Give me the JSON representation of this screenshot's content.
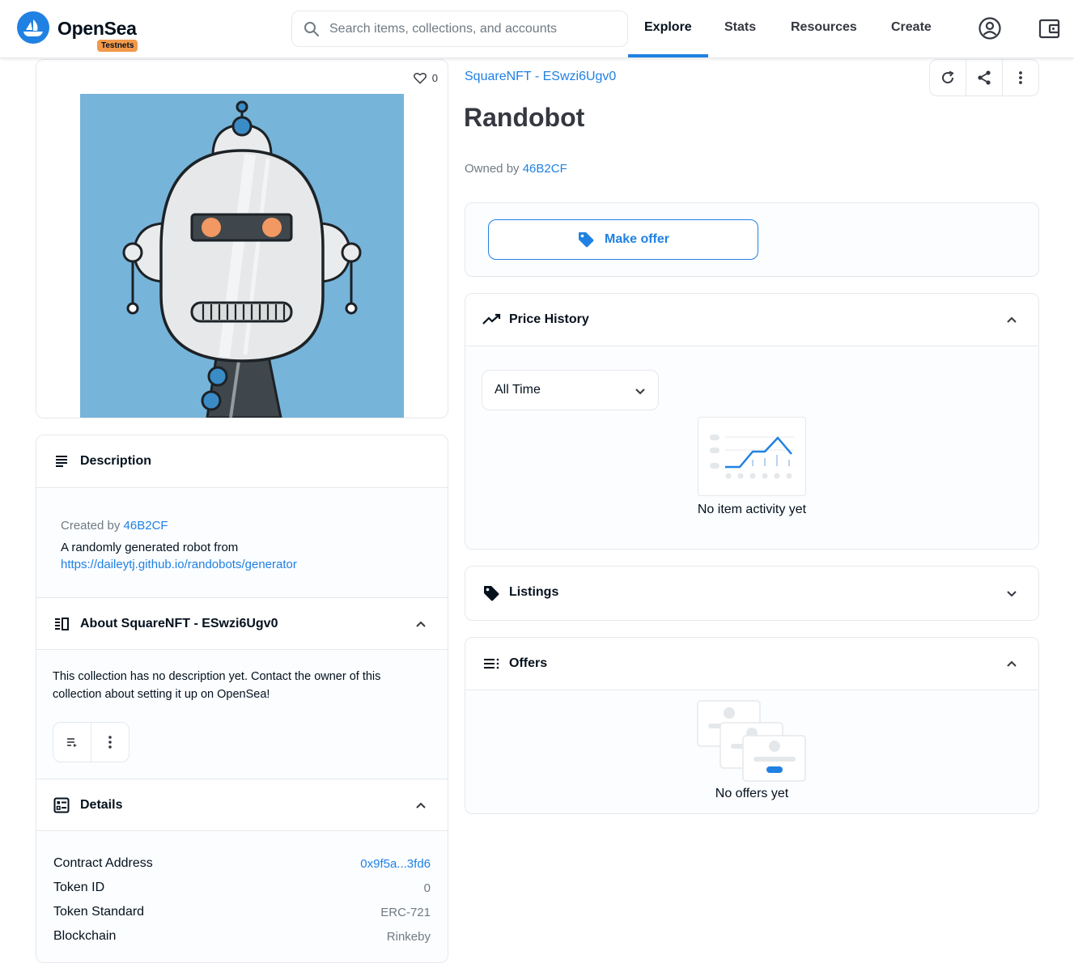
{
  "header": {
    "brand": "OpenSea",
    "badge": "Testnets",
    "search_placeholder": "Search items, collections, and accounts",
    "nav": [
      "Explore",
      "Stats",
      "Resources",
      "Create"
    ],
    "active_nav": "Explore",
    "accent_color": "#2081e2",
    "icons": [
      "opensea-logo-icon",
      "search-icon",
      "account-icon",
      "wallet-icon"
    ]
  },
  "item": {
    "collection": "SquareNFT - ESwzi6Ugv0",
    "title": "Randobot",
    "owned_by_label": "Owned by",
    "owner": "46B2CF",
    "favorites": "0",
    "image_alt_icon": "robot-illustration"
  },
  "actions": {
    "make_offer": "Make offer",
    "icons": [
      "refresh-icon",
      "share-icon",
      "more-vertical-icon"
    ]
  },
  "description": {
    "title": "Description",
    "created_by_label": "Created by",
    "creator": "46B2CF",
    "text": "A randomly generated robot from",
    "url": "https://daileytj.github.io/randobots/generator"
  },
  "about": {
    "title": "About SquareNFT - ESwzi6Ugv0",
    "text_line1": "This collection has no description yet. Contact the owner of this",
    "text_line2": "collection about setting it up on OpenSea!"
  },
  "details": {
    "title": "Details",
    "rows": [
      {
        "label": "Contract Address",
        "value": "0x9f5a...3fd6"
      },
      {
        "label": "Token ID",
        "value": "0"
      },
      {
        "label": "Token Standard",
        "value": "ERC-721"
      },
      {
        "label": "Blockchain",
        "value": "Rinkeby"
      }
    ]
  },
  "price_history": {
    "title": "Price History",
    "range_selected": "All Time",
    "empty": "No item activity yet"
  },
  "listings": {
    "title": "Listings"
  },
  "offers": {
    "title": "Offers",
    "empty": "No offers yet"
  }
}
